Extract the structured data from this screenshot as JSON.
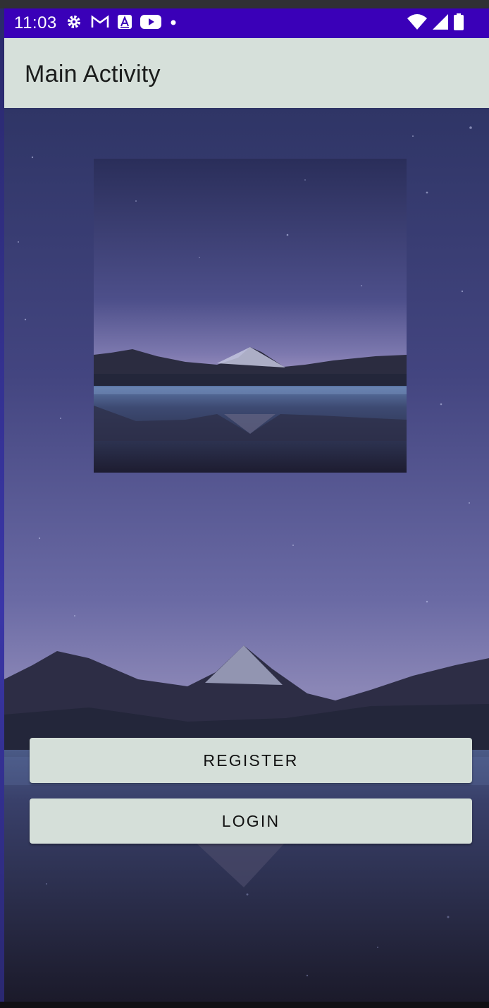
{
  "status_bar": {
    "time": "11:03",
    "left_icons": [
      "settings-icon",
      "gmail-icon",
      "font-app-icon",
      "youtube-icon",
      "dot-icon"
    ],
    "right_icons": [
      "wifi-icon",
      "signal-icon",
      "battery-icon"
    ]
  },
  "app_bar": {
    "title": "Main Activity"
  },
  "buttons": {
    "register_label": "REGISTER",
    "login_label": "LOGIN"
  },
  "colors": {
    "status_bar": "#3a00b8",
    "app_bar": "#d6e0da",
    "button": "#d5dfd9",
    "sky": "#4a4a85"
  }
}
